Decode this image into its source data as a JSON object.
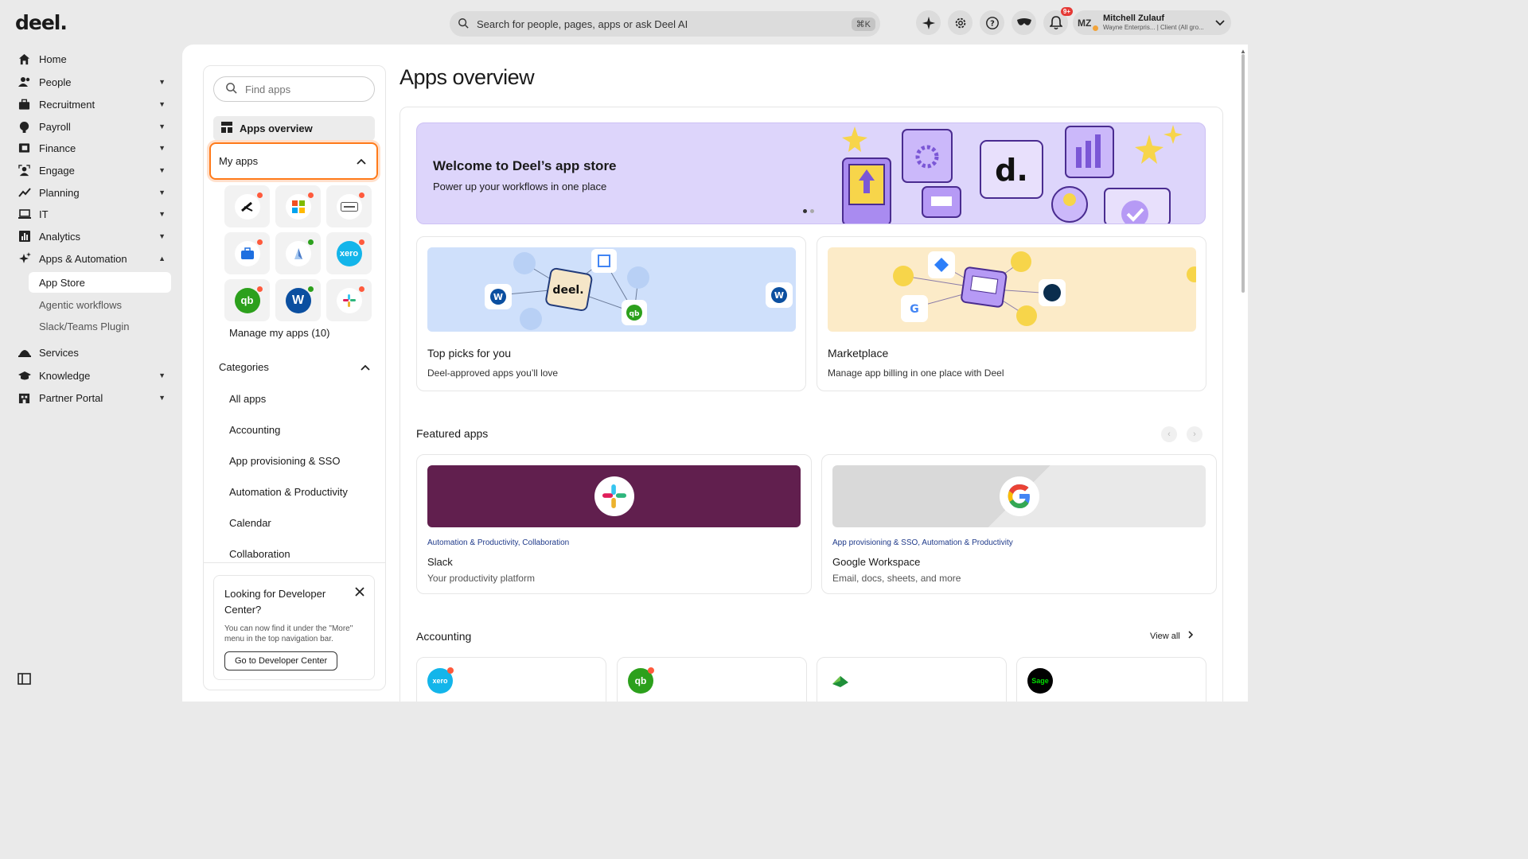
{
  "header": {
    "logo": "deel.",
    "search_placeholder": "Search for people, pages, apps or ask Deel AI",
    "search_shortcut": "⌘K",
    "notifications_badge": "9+",
    "user": {
      "initials": "MZ",
      "name": "Mitchell Zulauf",
      "org": "Wayne Enterpris... | Client (All gro..."
    }
  },
  "sidebar": {
    "items": [
      {
        "label": "Home",
        "icon": "home-icon"
      },
      {
        "label": "People",
        "icon": "people-icon"
      },
      {
        "label": "Recruitment",
        "icon": "briefcase-icon"
      },
      {
        "label": "Payroll",
        "icon": "payroll-icon"
      },
      {
        "label": "Finance",
        "icon": "finance-icon"
      },
      {
        "label": "Engage",
        "icon": "engage-icon"
      },
      {
        "label": "Planning",
        "icon": "planning-icon"
      },
      {
        "label": "IT",
        "icon": "laptop-icon"
      },
      {
        "label": "Analytics",
        "icon": "analytics-icon"
      },
      {
        "label": "Apps & Automation",
        "icon": "sparkle-icon"
      }
    ],
    "sub_items": [
      "App Store",
      "Agentic workflows",
      "Slack/Teams Plugin"
    ],
    "items_bottom": [
      {
        "label": "Services",
        "icon": "services-icon"
      },
      {
        "label": "Knowledge",
        "icon": "knowledge-icon"
      },
      {
        "label": "Partner Portal",
        "icon": "partner-icon"
      }
    ]
  },
  "left_panel": {
    "find_placeholder": "Find apps",
    "overview_label": "Apps overview",
    "my_apps_label": "My apps",
    "manage_label": "Manage my apps (10)",
    "categories_label": "Categories",
    "categories": [
      "All apps",
      "Accounting",
      "App provisioning & SSO",
      "Automation & Productivity",
      "Calendar",
      "Collaboration"
    ],
    "dev_card": {
      "title": "Looking for Developer Center?",
      "text": "You can now find it under the \"More\" menu in the top navigation bar.",
      "button": "Go to Developer Center"
    }
  },
  "main": {
    "title": "Apps overview",
    "hero": {
      "title": "Welcome to Deel’s app store",
      "subtitle": "Power up your workflows in one place"
    },
    "cards": [
      {
        "title": "Top picks for you",
        "subtitle": "Deel-approved apps you’ll love"
      },
      {
        "title": "Marketplace",
        "subtitle": "Manage app billing in one place with Deel"
      }
    ],
    "featured_title": "Featured apps",
    "featured": [
      {
        "cats": "Automation & Productivity, Collaboration",
        "name": "Slack",
        "desc": "Your productivity platform"
      },
      {
        "cats": "App provisioning & SSO, Automation & Productivity",
        "name": "Google Workspace",
        "desc": "Email, docs, sheets, and more"
      }
    ],
    "accounting_title": "Accounting",
    "view_all": "View all",
    "accounting_apps": [
      {
        "label": "xero",
        "color": "#13b5ea"
      },
      {
        "label": "qb",
        "color": "#2ca01c"
      },
      {
        "label": "",
        "color": "#ffffff"
      },
      {
        "label": "Sage",
        "color": "#000000"
      }
    ]
  },
  "colors": {
    "accent": "#ff7a1a",
    "hero_bg": "#ddd5fb",
    "slack_bg": "#611f4e"
  }
}
